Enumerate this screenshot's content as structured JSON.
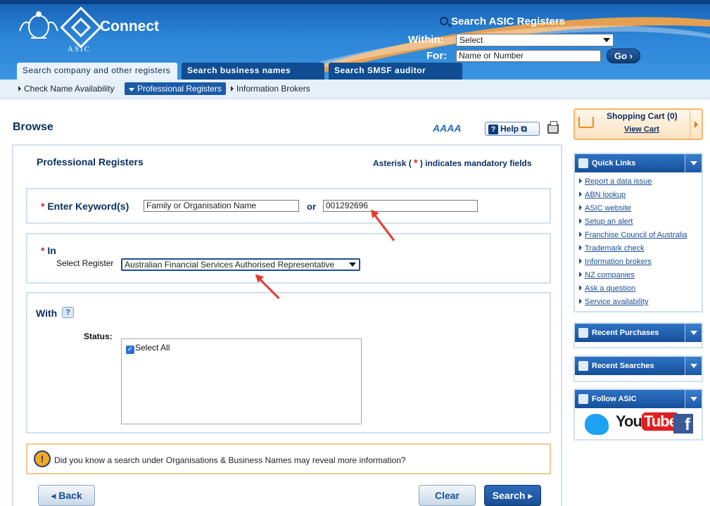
{
  "header": {
    "brand_logo_text": "ASIC",
    "app_name": "Connect",
    "search_title": "Search ASIC Registers",
    "within_label": "Within:",
    "within_value": "Select",
    "for_label": "For:",
    "for_placeholder": "Name or Number",
    "go_label": "Go"
  },
  "tabs": [
    {
      "label": "Search company and other registers",
      "active": true
    },
    {
      "label": "Search business names register",
      "active": false
    },
    {
      "label": "Search SMSF auditor register",
      "active": false
    }
  ],
  "subnav": [
    {
      "label": "Check Name Availability",
      "active": false
    },
    {
      "label": "Professional Registers",
      "active": true
    },
    {
      "label": "Information Brokers",
      "active": false
    }
  ],
  "main": {
    "page_title": "Browse",
    "text_size_icons": "AAAA",
    "help_label": "Help",
    "section_title": "Professional Registers",
    "mandatory_prefix": "Asterisk (",
    "mandatory_star": "*",
    "mandatory_suffix": ") indicates mandatory fields",
    "keyword_label": "Enter Keyword(s)",
    "keyword_value": "Family or Organisation Name",
    "or_label": "or",
    "number_value": "001292696",
    "in_label": "In",
    "select_register_label": "Select Register",
    "register_value": "Australian Financial Services Authorised Representative",
    "with_label": "With",
    "status_label": "Status:",
    "select_all_label": "Select All",
    "tip_text": "Did you know a search under Organisations & Business Names may reveal more information?",
    "back_label": "Back",
    "clear_label": "Clear",
    "search_label": "Search"
  },
  "sidebar": {
    "cart_title": "Shopping Cart (0)",
    "cart_link": "View Cart",
    "quick_links_title": "Quick Links",
    "quick_links": [
      "Report a data issue",
      "ABN lookup",
      "ASIC website",
      "Setup an alert",
      "Franchise Council of Australia",
      "Trademark check",
      "Information brokers",
      "NZ companies",
      "Ask a question",
      "Service availability"
    ],
    "recent_purchases_title": "Recent Purchases",
    "recent_searches_title": "Recent Searches",
    "follow_title": "Follow ASIC",
    "youtube_you": "You",
    "youtube_tube": "Tube",
    "facebook_letter": "f"
  },
  "colors": {
    "header_blue": "#2b84d6",
    "navy": "#0a3060",
    "required_red": "#d42020",
    "tip_orange": "#f5c891",
    "cart_orange": "#f5b56b"
  }
}
